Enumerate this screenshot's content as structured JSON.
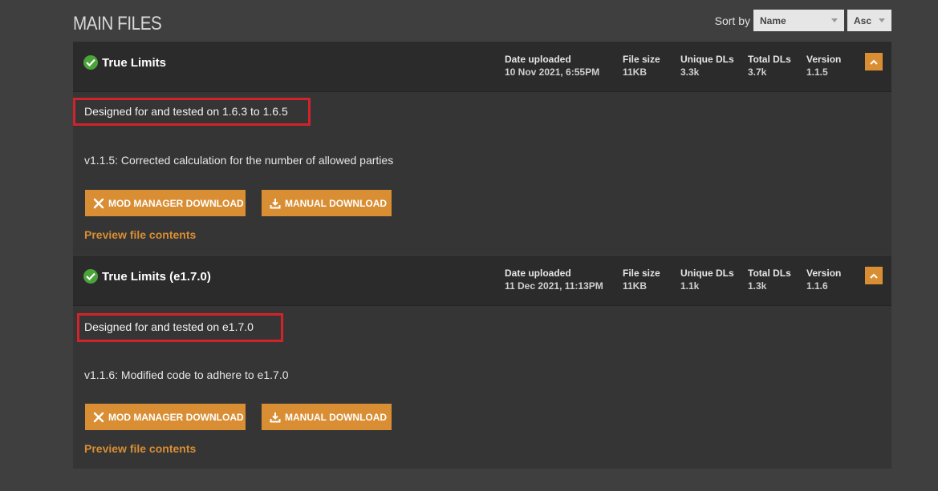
{
  "page": {
    "title": "MAIN FILES"
  },
  "sort": {
    "label": "Sort by",
    "field_value": "Name",
    "direction_value": "Asc"
  },
  "stat_labels": {
    "date": "Date uploaded",
    "size": "File size",
    "unique": "Unique DLs",
    "total": "Total DLs",
    "version": "Version"
  },
  "buttons": {
    "mod_manager": "MOD MANAGER DOWNLOAD",
    "manual": "MANUAL DOWNLOAD",
    "preview": "Preview file contents"
  },
  "files": [
    {
      "name": "True Limits",
      "date": "10 Nov 2021, 6:55PM",
      "size": "11KB",
      "unique": "3.3k",
      "total": "3.7k",
      "version": "1.1.5",
      "description": "Designed for and tested on 1.6.3 to 1.6.5",
      "changelog": "v1.1.5: Corrected calculation for the number of allowed parties"
    },
    {
      "name": "True Limits (e1.7.0)",
      "date": "11 Dec 2021, 11:13PM",
      "size": "11KB",
      "unique": "1.1k",
      "total": "1.3k",
      "version": "1.1.6",
      "description": "Designed for and tested on e1.7.0",
      "changelog": "v1.1.6: Modified code to adhere to e1.7.0"
    }
  ],
  "colors": {
    "accent": "#d98e33",
    "highlight_box": "#d2232a",
    "check": "#4aa43a"
  },
  "icons": {
    "check": "check-circle-icon",
    "collapse": "chevron-up-icon",
    "mod_manager": "vortex-icon",
    "manual": "download-icon"
  }
}
